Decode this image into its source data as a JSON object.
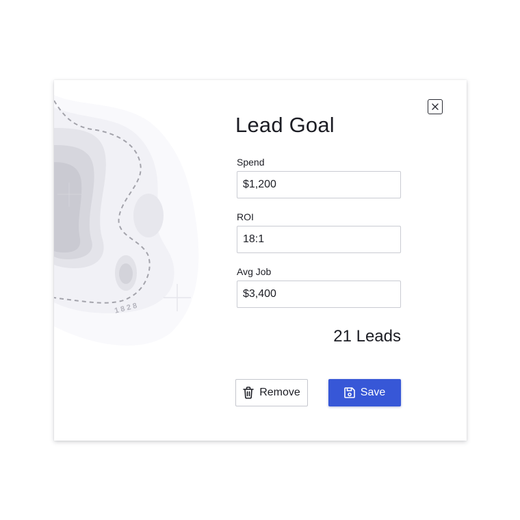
{
  "dialog": {
    "title": "Lead Goal",
    "close_icon": "close-icon",
    "map_watermark": "1828"
  },
  "fields": [
    {
      "label": "Spend",
      "value": "$1,200"
    },
    {
      "label": "ROI",
      "value": "18:1"
    },
    {
      "label": "Avg Job",
      "value": "$3,400"
    }
  ],
  "result": {
    "count": "21",
    "unit": "Leads"
  },
  "actions": {
    "remove_label": "Remove",
    "remove_icon": "trash-icon",
    "save_label": "Save",
    "save_icon": "floppy-disk-icon"
  },
  "colors": {
    "primary": "#3757d7",
    "text": "#1c1d24",
    "border": "#c9cbd2"
  }
}
